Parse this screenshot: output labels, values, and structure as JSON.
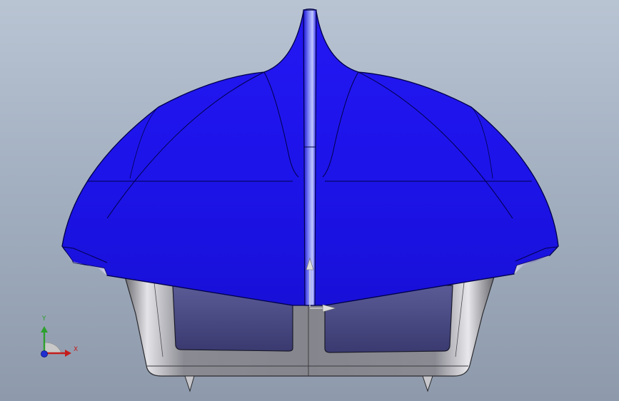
{
  "viewport": {
    "background_top": "#b9c4d3",
    "background_bottom": "#8e9aab"
  },
  "model": {
    "cover_color": "#1a12e8",
    "cover_edge_color": "#00004a",
    "body_color": "#9a9aa2",
    "window_color": "#4a4a80",
    "selection_arrow_color": "#d8d8d8"
  },
  "triad": {
    "x_label": "X",
    "y_label": "Y",
    "x_color": "#c41d1d",
    "y_color": "#2da02d",
    "z_color": "#1f2fd0"
  }
}
